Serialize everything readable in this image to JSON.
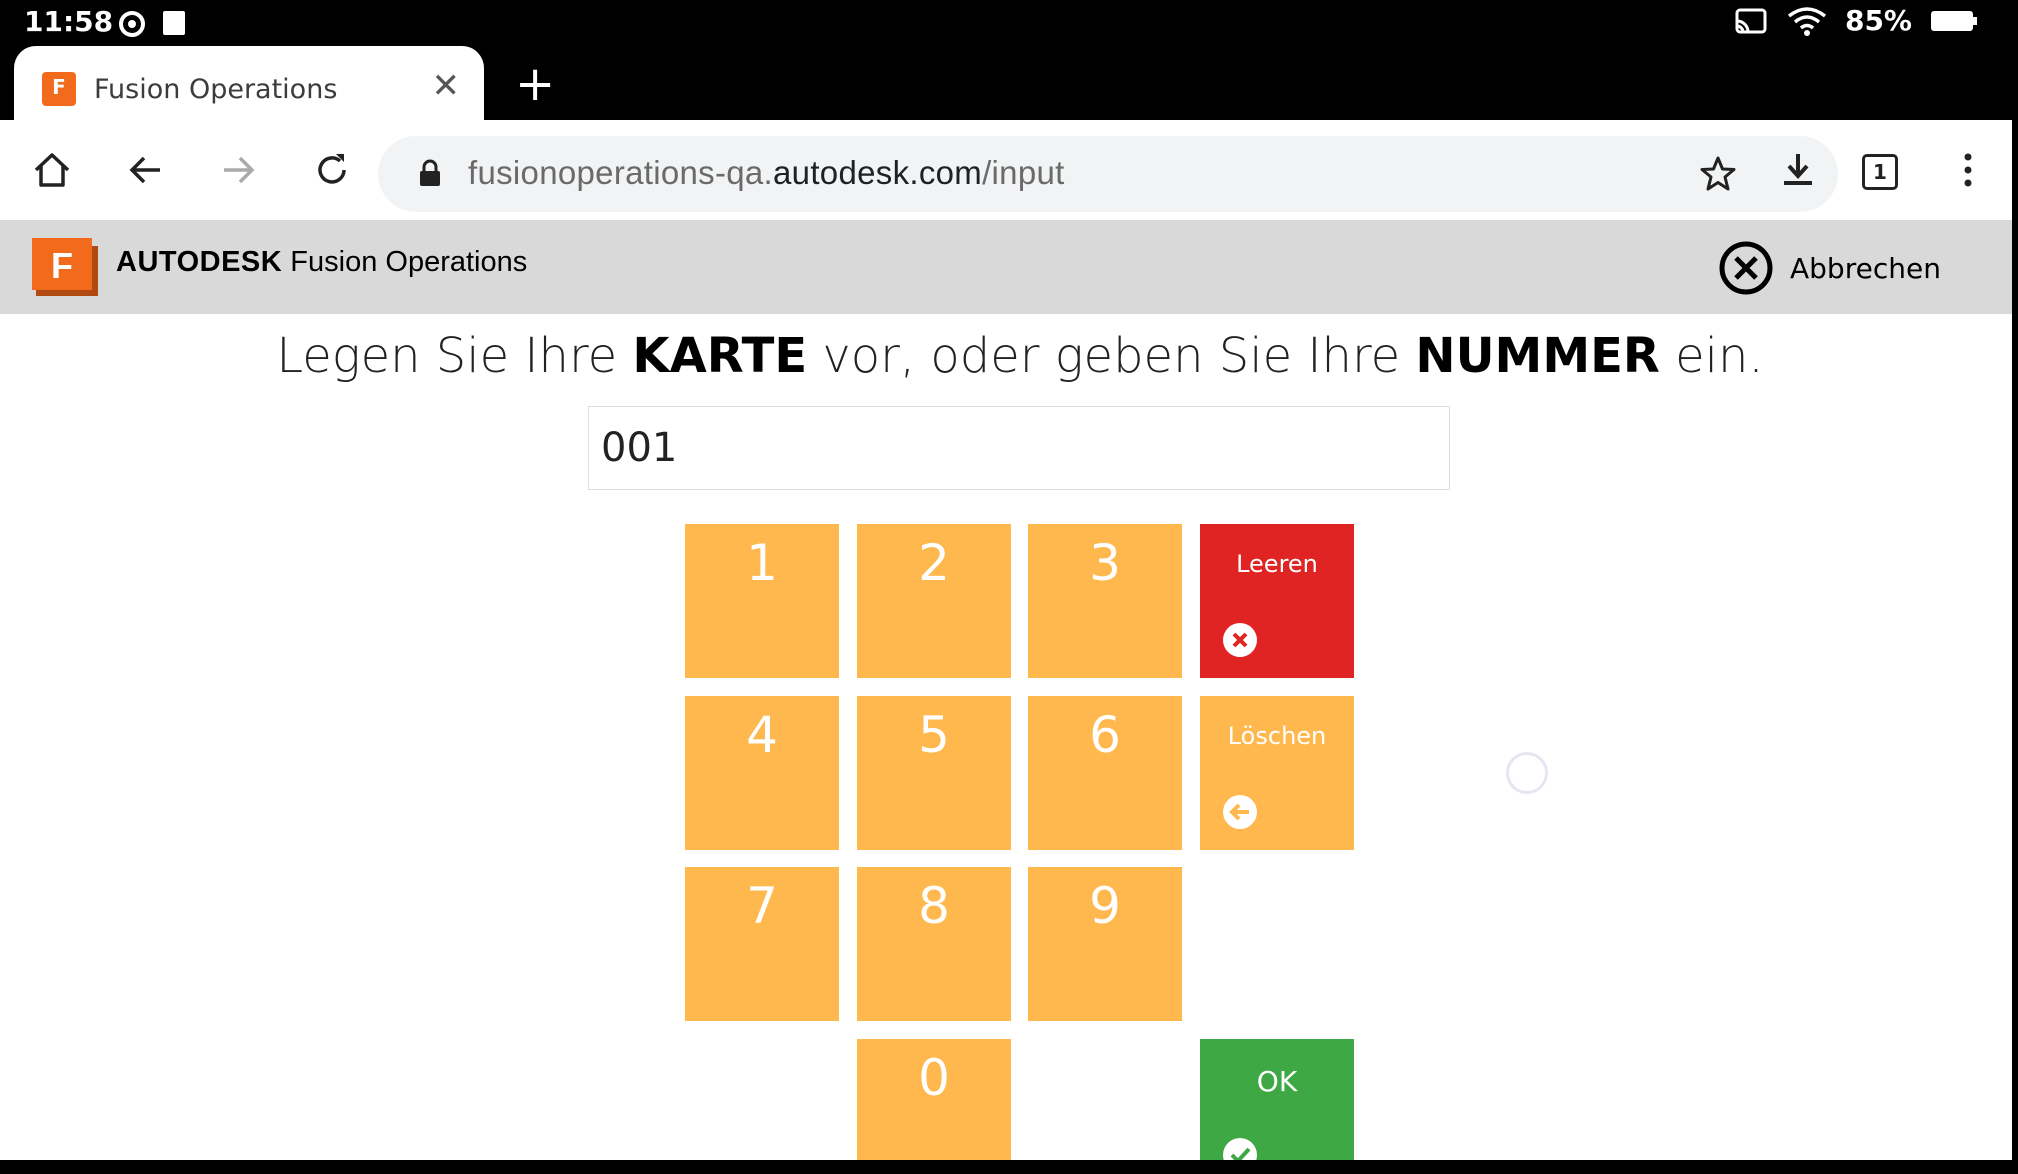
{
  "status_bar": {
    "time": "11:58",
    "battery": "85%"
  },
  "tab": {
    "title": "Fusion Operations"
  },
  "address_bar": {
    "url_prefix": "fusionoperations-qa.",
    "url_domain": "autodesk.com",
    "url_path": "/input",
    "tab_count": "1"
  },
  "app_header": {
    "brand_bold": "AUTODESK",
    "brand_rest": "Fusion Operations",
    "cancel_label": "Abbrechen",
    "logo_letter": "F"
  },
  "main": {
    "prompt_part1": "Legen Sie Ihre ",
    "prompt_bold1": "KARTE",
    "prompt_part2": " vor, oder geben Sie Ihre ",
    "prompt_bold2": "NUMMER",
    "prompt_part3": " ein.",
    "input_value": "001"
  },
  "keypad": {
    "digits": [
      "1",
      "2",
      "3",
      "4",
      "5",
      "6",
      "7",
      "8",
      "9",
      "0"
    ],
    "clear_label": "Leeren",
    "delete_label": "Löschen",
    "ok_label": "OK"
  },
  "colors": {
    "key": "#ffb84d",
    "clear": "#e02424",
    "ok": "#3ea844",
    "brand_orange": "#f26a1b"
  }
}
